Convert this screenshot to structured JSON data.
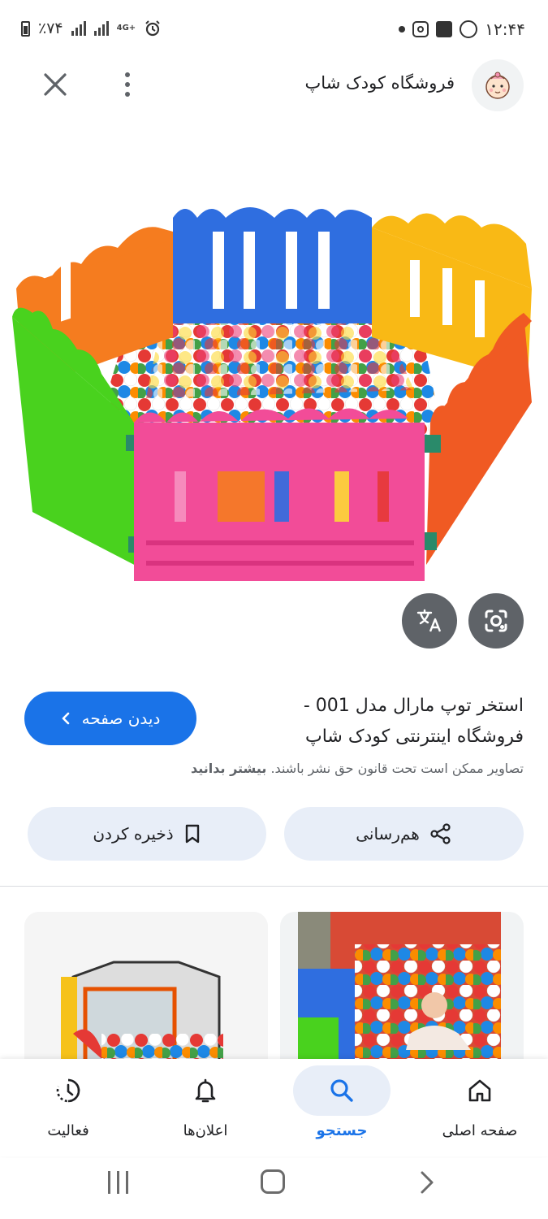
{
  "status_bar": {
    "battery": "٪۷۴",
    "network": "4G+",
    "time": "۱۲:۴۴"
  },
  "header": {
    "site_name": "فروشگاه کودک شاپ",
    "icons": [
      "close-icon",
      "more-vert-icon",
      "baby-face-icon"
    ]
  },
  "result": {
    "title": "استخر توپ مارال مدل 001 - فروشگاه اینترنتی کودک شاپ",
    "visit_label": "دیدن صفحه",
    "copyright_text": "تصاویر ممکن است تحت قانون حق نشر باشند.",
    "learn_more": "بیشتر بدانید"
  },
  "actions": {
    "share_label": "هم‌رسانی",
    "save_label": "ذخیره کردن"
  },
  "bottom_nav": {
    "items": [
      {
        "label": "صفحه اصلی",
        "icon": "home-icon",
        "active": false
      },
      {
        "label": "جستجو",
        "icon": "search-icon",
        "active": true
      },
      {
        "label": "اعلان‌ها",
        "icon": "bell-icon",
        "active": false
      },
      {
        "label": "فعالیت",
        "icon": "activity-icon",
        "active": false
      }
    ]
  },
  "colors": {
    "accent": "#1a73e8",
    "pill_bg": "#e8eef8",
    "overlay_btn": "#5f6368"
  }
}
